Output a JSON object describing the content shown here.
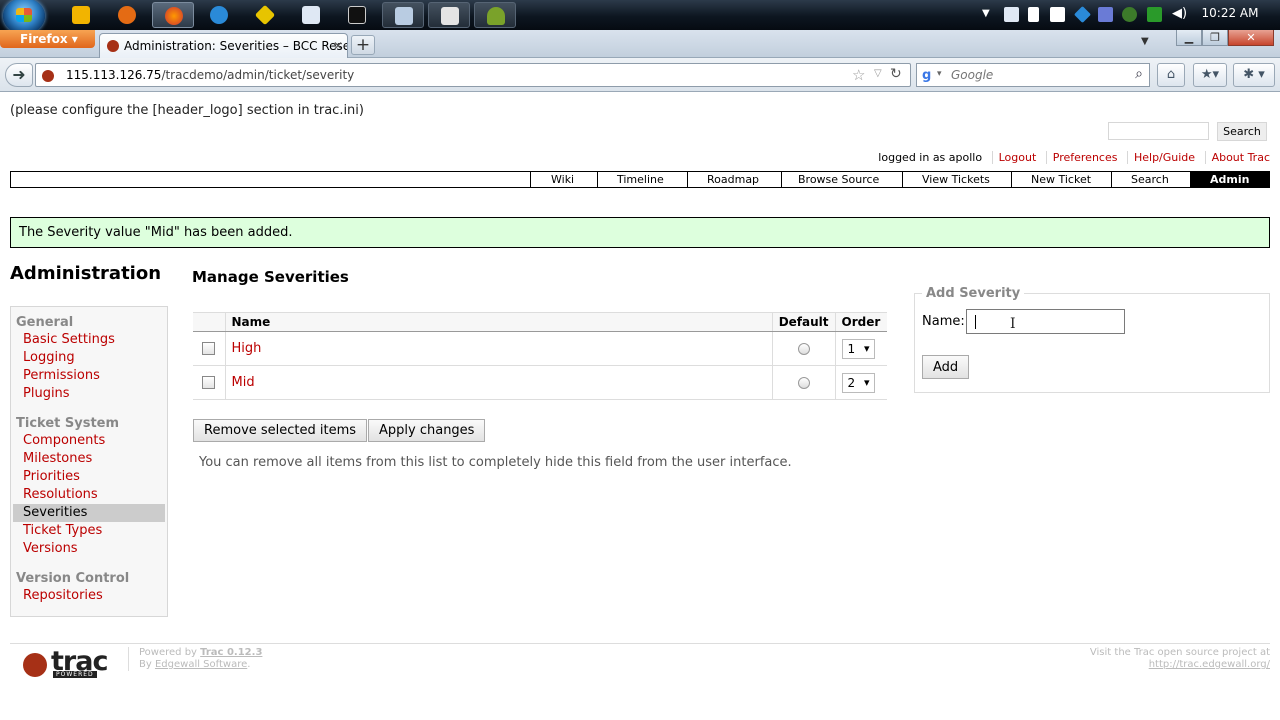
{
  "taskbar": {
    "clock": "10:22 AM",
    "apps": [
      "start-orb",
      "notepad",
      "firefox-beta",
      "firefox",
      "internet-explorer",
      "app-diamond",
      "document",
      "terminal",
      "explorer",
      "media",
      "android"
    ]
  },
  "browser": {
    "firefox_button": "Firefox",
    "tab_title": "Administration: Severities – BCC Researc...",
    "new_tab": "+",
    "url_host": "115.113.126.75",
    "url_path": "/tracdemo/admin/ticket/severity",
    "search_placeholder": "Google",
    "search_engine_glyph": "g"
  },
  "trac": {
    "header_logo_text": "(please configure the [header_logo] section in trac.ini)",
    "search_button": "Search",
    "metanav": {
      "logged_in": "logged in as apollo",
      "logout": "Logout",
      "preferences": "Preferences",
      "help": "Help/Guide",
      "about": "About Trac"
    },
    "mainnav": [
      "Wiki",
      "Timeline",
      "Roadmap",
      "Browse Source",
      "View Tickets",
      "New Ticket",
      "Search",
      "Admin"
    ],
    "notice": "The Severity value \"Mid\" has been added.",
    "admin_title": "Administration",
    "admin_nav": {
      "general": "General",
      "basic_settings": "Basic Settings",
      "logging": "Logging",
      "permissions": "Permissions",
      "plugins": "Plugins",
      "ticket_system": "Ticket System",
      "components": "Components",
      "milestones": "Milestones",
      "priorities": "Priorities",
      "resolutions": "Resolutions",
      "severities": "Severities",
      "ticket_types": "Ticket Types",
      "versions": "Versions",
      "version_control": "Version Control",
      "repositories": "Repositories"
    },
    "panel_title": "Manage Severities",
    "table": {
      "headers": {
        "name": "Name",
        "default": "Default",
        "order": "Order"
      },
      "rows": [
        {
          "name": "High",
          "order": "1"
        },
        {
          "name": "Mid",
          "order": "2"
        }
      ]
    },
    "remove_button": "Remove selected items",
    "apply_button": "Apply changes",
    "hint": "You can remove all items from this list to completely hide this field from the user interface.",
    "add_form": {
      "legend": "Add Severity",
      "name_label": "Name:",
      "name_value": "",
      "add_button": "Add"
    },
    "footer": {
      "powered_by": "Powered by",
      "trac_version": "Trac 0.12.3",
      "by": "By",
      "edgewall": "Edgewall Software",
      "right_line1": "Visit the Trac open source project at",
      "right_line2": "http://trac.edgewall.org/",
      "logo_word": "trac",
      "logo_powered": "POWERED"
    }
  }
}
